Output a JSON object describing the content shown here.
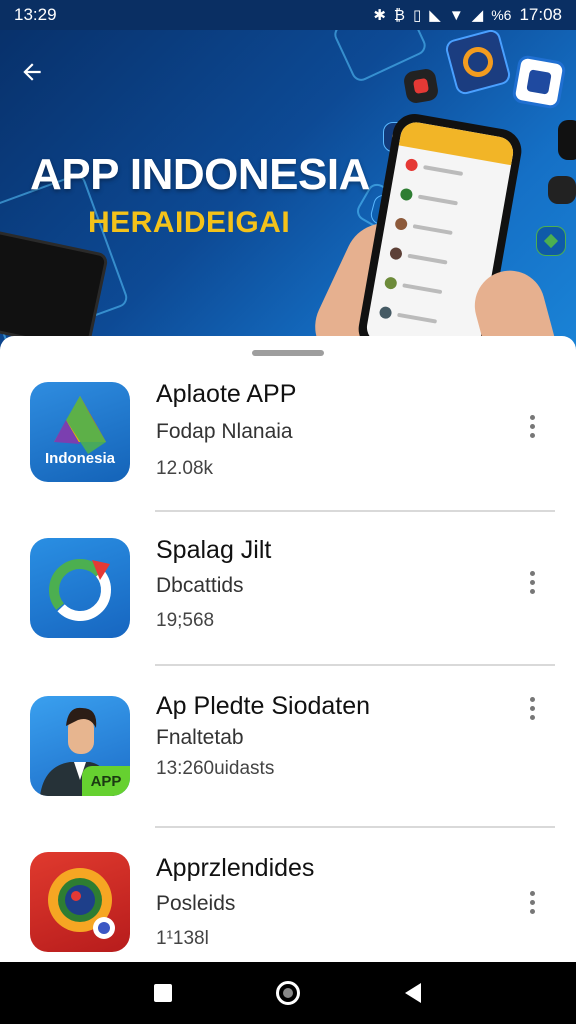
{
  "status_bar": {
    "time_left": "13:29",
    "time_right": "17:08",
    "indicators": [
      "bluetooth-icon",
      "nfc-icon",
      "vibrate-icon",
      "signal-icon",
      "wifi-icon",
      "battery-icon"
    ],
    "battery_text": "%6"
  },
  "hero": {
    "title": "APP INDONESIA",
    "subtitle": "HERAIDEIGAI",
    "background_color": "#0d4a95",
    "subtitle_color": "#f4c21a"
  },
  "apps": [
    {
      "name": "Aplaote APP",
      "category": "Fodap Nlanaia",
      "downloads": "12.08k",
      "icon": "drive-triangle-icon",
      "icon_label": "Indonesia"
    },
    {
      "name": "Spalag Jilt",
      "category": "Dbcattids",
      "downloads": "19;568",
      "icon": "circular-arrow-icon"
    },
    {
      "name": "Ap Pledte Siodaten",
      "category": "Fnaltetab",
      "downloads": "13:260uidasts",
      "icon": "businessman-avatar-icon",
      "icon_label": "APP"
    },
    {
      "name": "Apprzlendides",
      "category": "Posleids",
      "downloads": "1¹138l",
      "icon": "camera-lens-icon"
    }
  ]
}
